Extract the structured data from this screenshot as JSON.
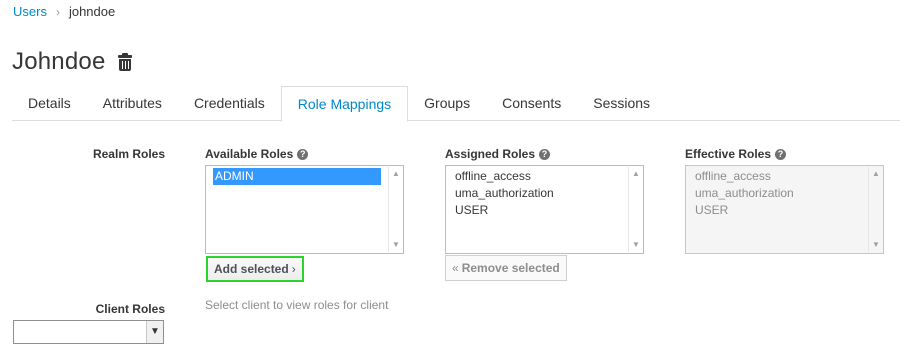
{
  "breadcrumb": {
    "root": "Users",
    "separator": "›",
    "current": "johndoe"
  },
  "page": {
    "title": "Johndoe"
  },
  "tabs": [
    {
      "label": "Details"
    },
    {
      "label": "Attributes"
    },
    {
      "label": "Credentials"
    },
    {
      "label": "Role Mappings",
      "active": true
    },
    {
      "label": "Groups"
    },
    {
      "label": "Consents"
    },
    {
      "label": "Sessions"
    }
  ],
  "realm_roles": {
    "label": "Realm Roles",
    "available": {
      "heading": "Available Roles",
      "items": [
        "ADMIN"
      ],
      "selected": "ADMIN"
    },
    "assigned": {
      "heading": "Assigned Roles",
      "items": [
        "offline_access",
        "uma_authorization",
        "USER"
      ]
    },
    "effective": {
      "heading": "Effective Roles",
      "items": [
        "offline_access",
        "uma_authorization",
        "USER"
      ]
    },
    "add_button": "Add selected",
    "remove_button": "Remove selected"
  },
  "client_roles": {
    "label": "Client Roles",
    "hint": "Select client to view roles for client",
    "selected_value": ""
  },
  "colors": {
    "link": "#0088ce",
    "highlight_border": "#2bd42b",
    "selection": "#3399ff"
  }
}
